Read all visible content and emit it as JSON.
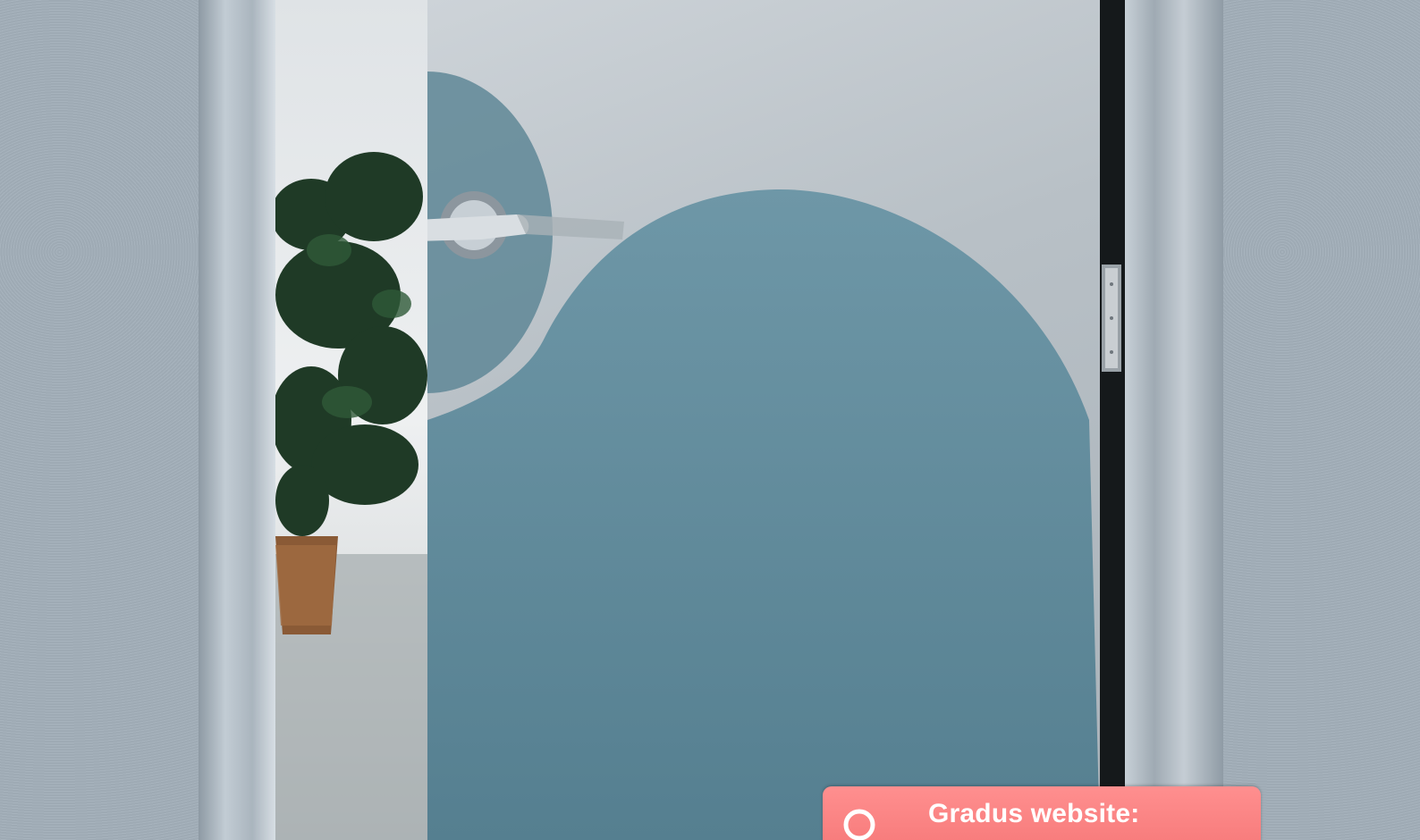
{
  "badge": {
    "text": "Gradus website:",
    "icon": "search-icon",
    "color": "#f47474"
  },
  "palette": {
    "wall": "#9eaab4",
    "door_panel": "#5f8797",
    "frame": "#b9c3cb"
  }
}
